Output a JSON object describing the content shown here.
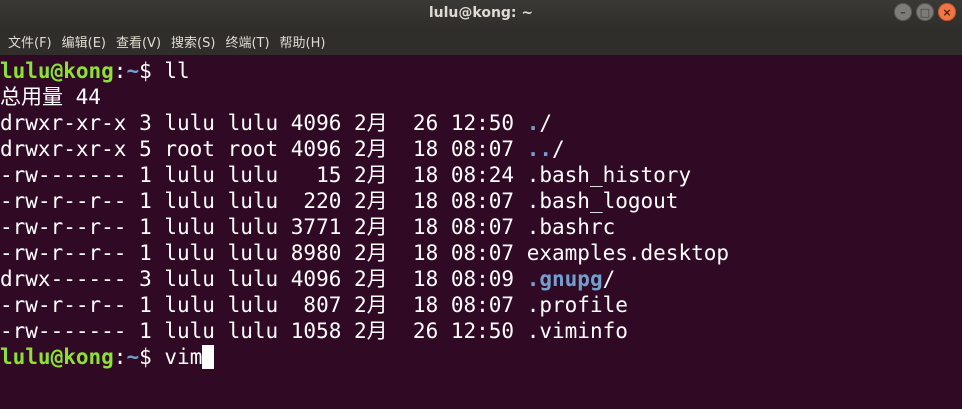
{
  "window": {
    "title": "lulu@kong: ~"
  },
  "menu": [
    "文件(F)",
    "编辑(E)",
    "查看(V)",
    "搜索(S)",
    "终端(T)",
    "帮助(H)"
  ],
  "prompt": {
    "user": "lulu@kong",
    "sep": ":",
    "path": "~",
    "symbol": "$ "
  },
  "command1": "ll",
  "total_line": "总用量 44",
  "listing": [
    {
      "meta": "drwxr-xr-x 3 lulu lulu 4096 2月  26 12:50 ",
      "name": ".",
      "suffix": "/",
      "is_dir": true
    },
    {
      "meta": "drwxr-xr-x 5 root root 4096 2月  18 08:07 ",
      "name": "..",
      "suffix": "/",
      "is_dir": true
    },
    {
      "meta": "-rw------- 1 lulu lulu   15 2月  18 08:24 ",
      "name": ".bash_history",
      "suffix": "",
      "is_dir": false
    },
    {
      "meta": "-rw-r--r-- 1 lulu lulu  220 2月  18 08:07 ",
      "name": ".bash_logout",
      "suffix": "",
      "is_dir": false
    },
    {
      "meta": "-rw-r--r-- 1 lulu lulu 3771 2月  18 08:07 ",
      "name": ".bashrc",
      "suffix": "",
      "is_dir": false
    },
    {
      "meta": "-rw-r--r-- 1 lulu lulu 8980 2月  18 08:07 ",
      "name": "examples.desktop",
      "suffix": "",
      "is_dir": false
    },
    {
      "meta": "drwx------ 3 lulu lulu 4096 2月  18 08:09 ",
      "name": ".gnupg",
      "suffix": "/",
      "is_dir": true
    },
    {
      "meta": "-rw-r--r-- 1 lulu lulu  807 2月  18 08:07 ",
      "name": ".profile",
      "suffix": "",
      "is_dir": false
    },
    {
      "meta": "-rw------- 1 lulu lulu 1058 2月  26 12:50 ",
      "name": ".viminfo",
      "suffix": "",
      "is_dir": false
    }
  ],
  "command2": "vim",
  "colors": {
    "background": "#300a24",
    "prompt_user": "#8ae234",
    "prompt_path": "#729fcf",
    "directory": "#729fcf"
  }
}
